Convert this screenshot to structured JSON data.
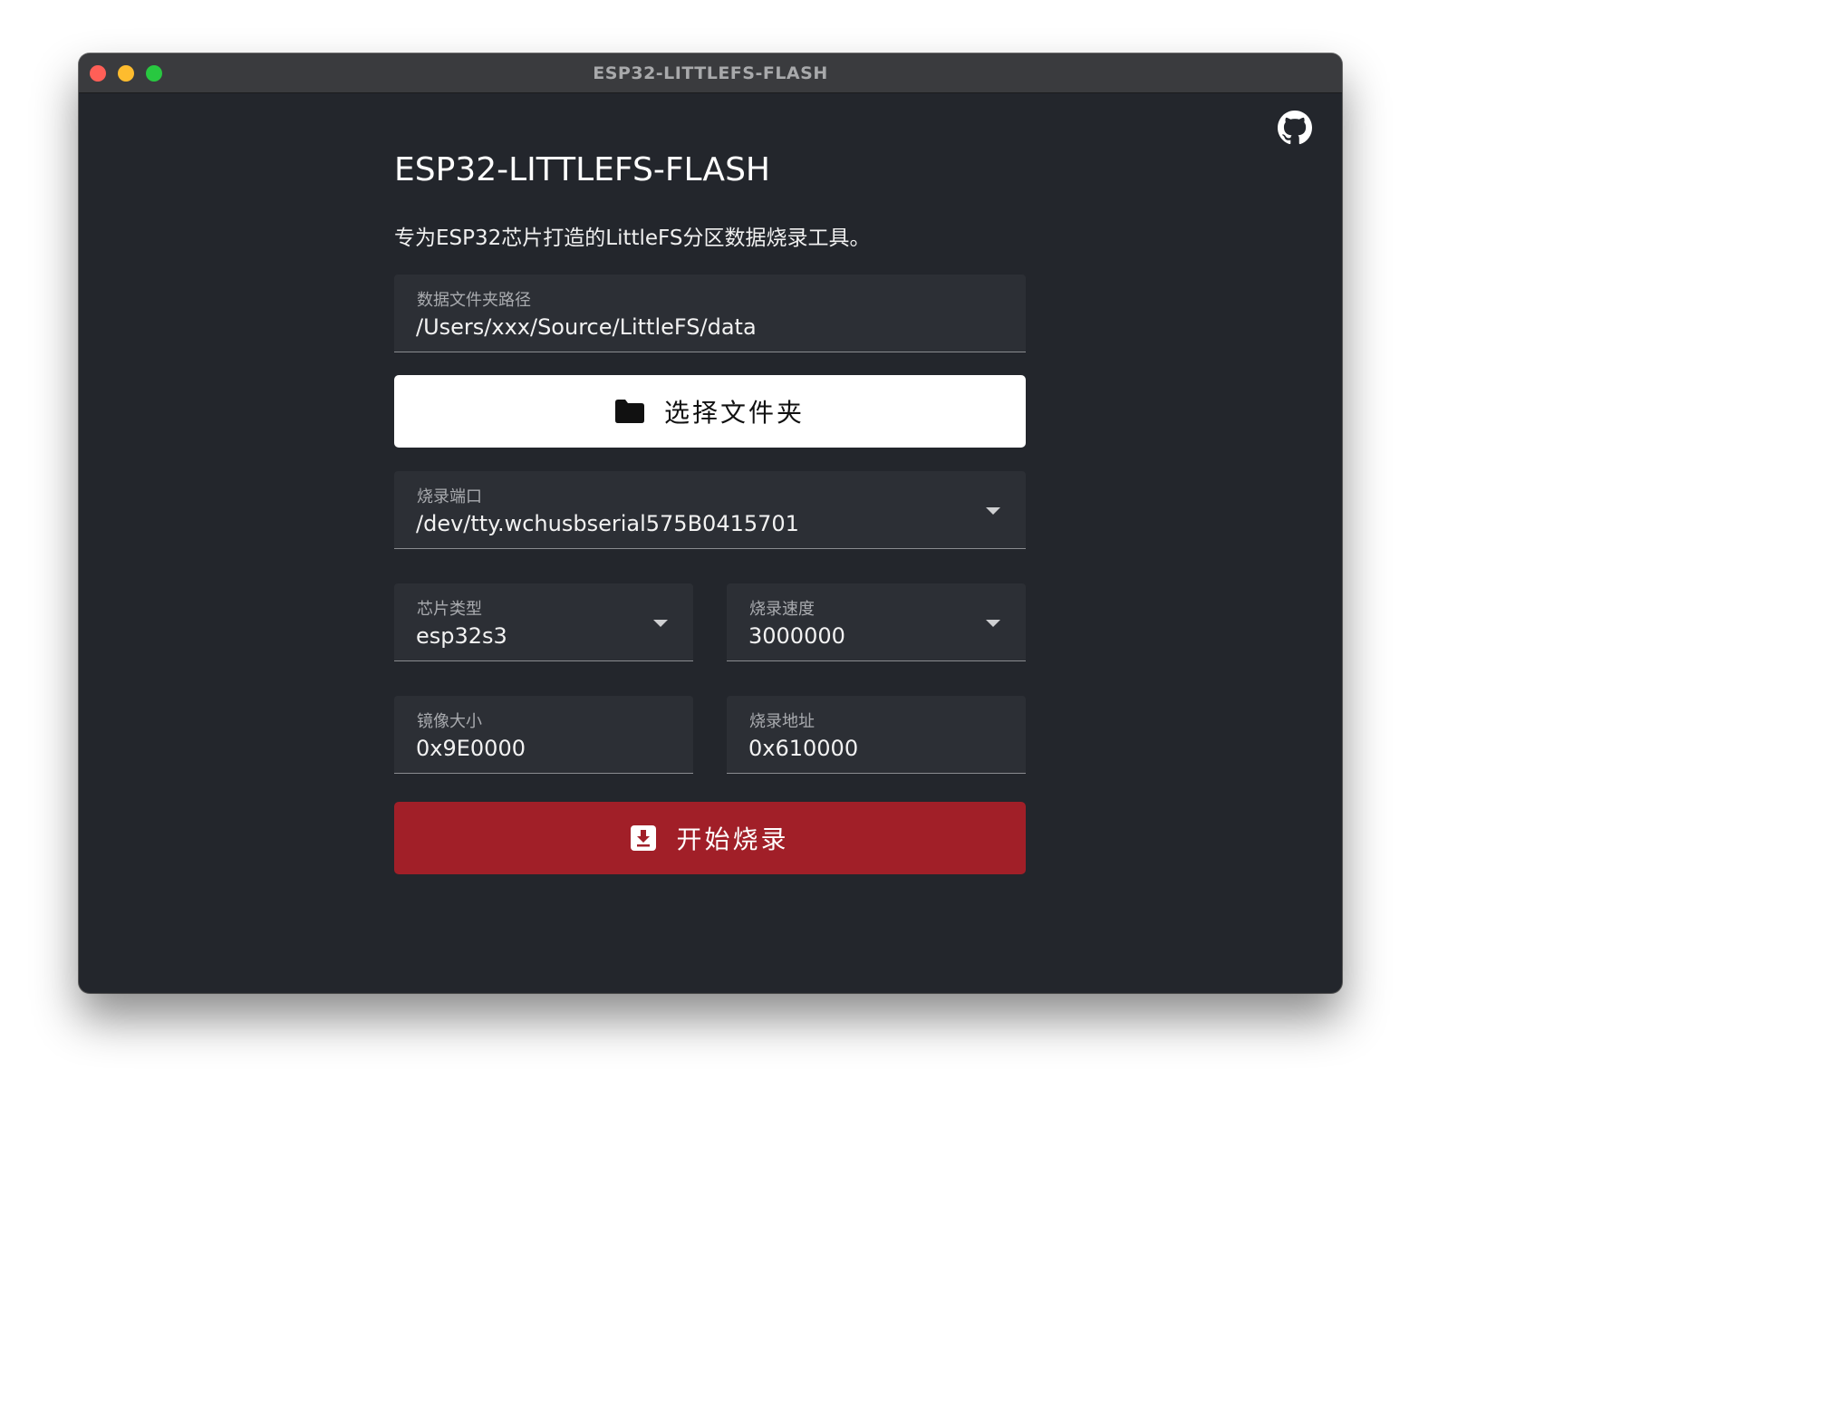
{
  "window": {
    "title": "ESP32-LITTLEFS-FLASH"
  },
  "header": {
    "title": "ESP32-LITTLEFS-FLASH",
    "subtitle": "专为ESP32芯片打造的LittleFS分区数据烧录工具。"
  },
  "data_folder": {
    "label": "数据文件夹路径",
    "value": "/Users/xxx/Source/LittleFS/data"
  },
  "select_folder_button": {
    "label": "选择文件夹",
    "icon": "folder-icon"
  },
  "port": {
    "label": "烧录端口",
    "value": "/dev/tty.wchusbserial575B0415701"
  },
  "chip_type": {
    "label": "芯片类型",
    "value": "esp32s3"
  },
  "baud_rate": {
    "label": "烧录速度",
    "value": "3000000"
  },
  "image_size": {
    "label": "镜像大小",
    "value": "0x9E0000"
  },
  "flash_address": {
    "label": "烧录地址",
    "value": "0x610000"
  },
  "flash_button": {
    "label": "开始烧录",
    "icon": "download-icon"
  },
  "colors": {
    "background": "#23262c",
    "field_bg": "#2c2f35",
    "primary_button": "#a11f28",
    "secondary_button": "#ffffff"
  }
}
